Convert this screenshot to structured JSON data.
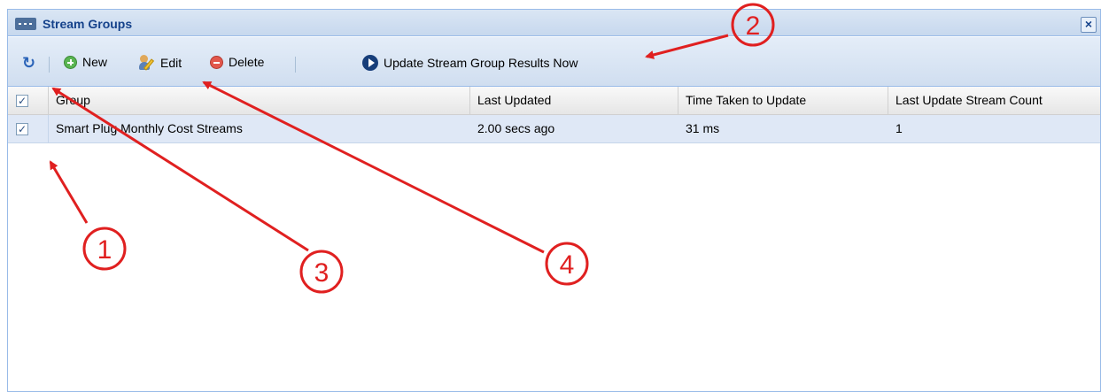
{
  "window": {
    "title": "Stream Groups",
    "close_label": "×"
  },
  "toolbar": {
    "refresh_icon": "↻",
    "new_label": "New",
    "edit_label": "Edit",
    "delete_label": "Delete",
    "update_label": "Update Stream Group Results Now"
  },
  "grid": {
    "columns": [
      "Group",
      "Last Updated",
      "Time Taken to Update",
      "Last Update Stream Count"
    ],
    "header_checkbox": "✓",
    "rows": [
      {
        "checkbox": "✓",
        "group": "Smart Plug Monthly Cost Streams",
        "last_updated": "2.00 secs ago",
        "time_taken": "31 ms",
        "stream_count": "1"
      }
    ]
  },
  "annotations": {
    "labels": [
      "1",
      "2",
      "3",
      "4"
    ],
    "color": "#e02020"
  },
  "colors": {
    "title_text": "#15428b",
    "border": "#99bbe8",
    "selected_row": "#dfe8f6"
  }
}
